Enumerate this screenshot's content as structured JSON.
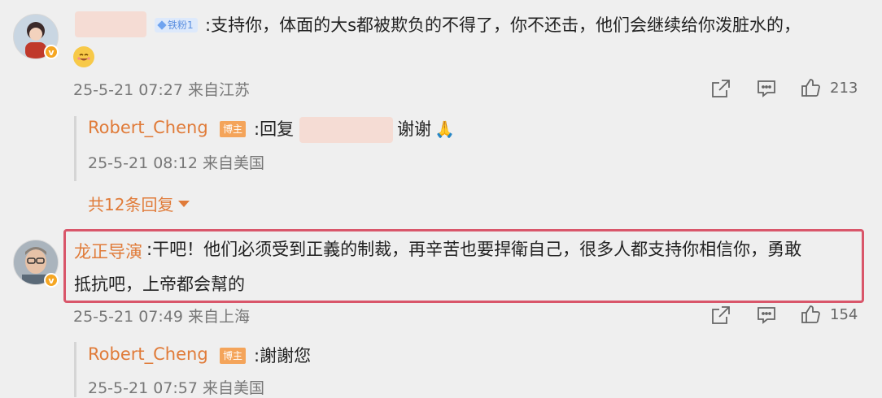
{
  "comments": [
    {
      "badge": "铁粉1",
      "text": ":支持你，体面的大s都被欺负的不得了，你不还击，他们会继续给你泼脏水的，",
      "time": "25-5-21 07:27 来自江苏",
      "likes": "213",
      "replies": [
        {
          "name": "Robert_Cheng",
          "badge": "博主",
          "prefix": ":回复",
          "suffix": "谢谢",
          "emoji": "🙏",
          "time": "25-5-21 08:12 来自美国"
        }
      ],
      "more_replies": "共12条回复"
    },
    {
      "name": "龙正导演",
      "text_line1": ":干吧！他们必须受到正義的制裁，再辛苦也要捍衛自己，很多人都支持你相信你，勇敢",
      "text_line2": "抵抗吧，上帝都会幫的",
      "time": "25-5-21 07:49 来自上海",
      "likes": "154",
      "replies": [
        {
          "name": "Robert_Cheng",
          "badge": "博主",
          "text": ":謝謝您",
          "time": "25-5-21 07:57 来自美国"
        }
      ]
    }
  ],
  "colors": {
    "name": "#e07b39",
    "highlight_border": "#d9566a",
    "background": "#efefef"
  },
  "icons": [
    "share-icon",
    "comment-icon",
    "like-icon",
    "emoji-smile-icon",
    "verified-icon",
    "caret-down-icon"
  ]
}
